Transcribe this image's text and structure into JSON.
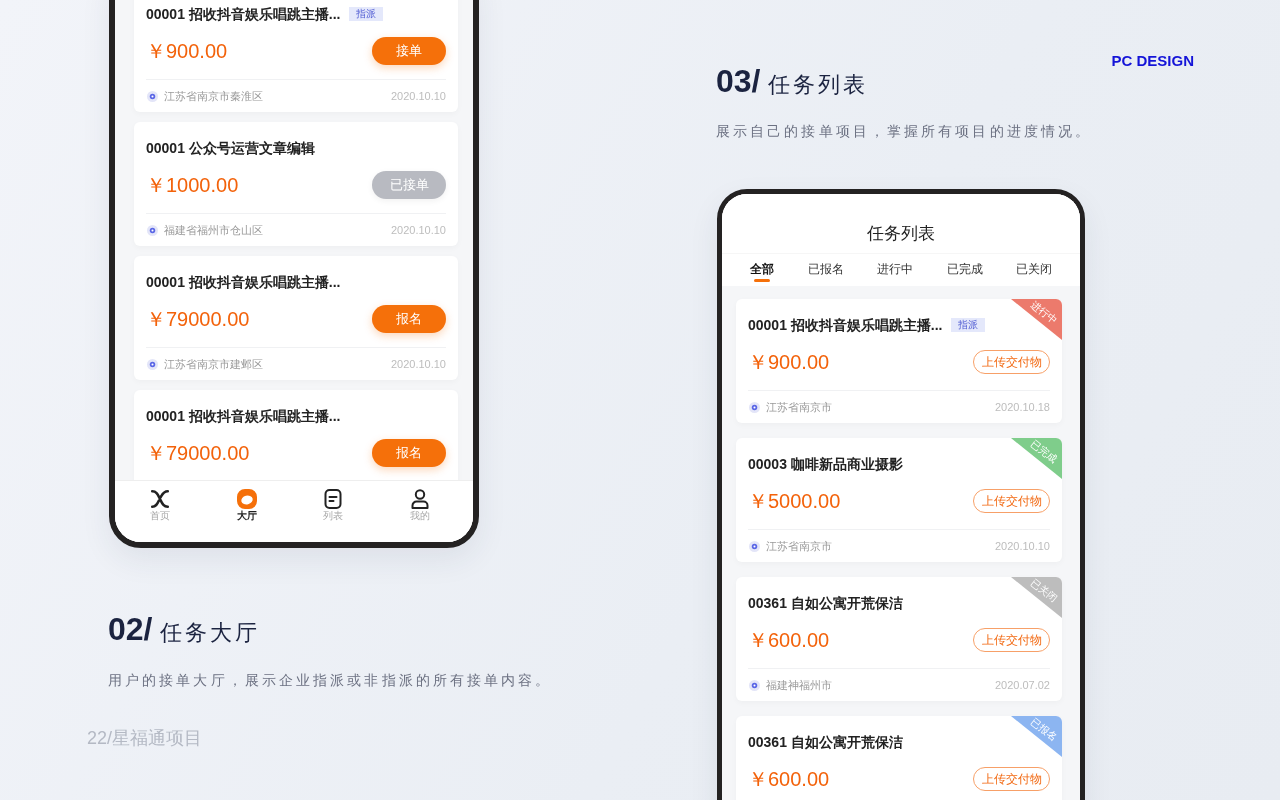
{
  "hall_phone": {
    "cards": [
      {
        "title": "00001 招收抖音娱乐唱跳主播...",
        "tag": "指派",
        "price": "￥900.00",
        "button": {
          "label": "接单",
          "disabled": false
        },
        "location": "江苏省南京市秦淮区",
        "date": "2020.10.10"
      },
      {
        "title": "00001 公众号运营文章编辑",
        "price": "￥1000.00",
        "button": {
          "label": "已接单",
          "disabled": true
        },
        "location": "福建省福州市仓山区",
        "date": "2020.10.10"
      },
      {
        "title": "00001 招收抖音娱乐唱跳主播...",
        "price": "￥79000.00",
        "button": {
          "label": "报名",
          "disabled": false
        },
        "location": "江苏省南京市建邺区",
        "date": "2020.10.10"
      },
      {
        "title": "00001 招收抖音娱乐唱跳主播...",
        "price": "￥79000.00",
        "button": {
          "label": "报名",
          "disabled": false
        }
      }
    ],
    "tab_bar": [
      {
        "label": "首页",
        "selected": false
      },
      {
        "label": "大厅",
        "selected": true
      },
      {
        "label": "列表",
        "selected": false
      },
      {
        "label": "我的",
        "selected": false
      }
    ]
  },
  "list_section": {
    "number": "03/",
    "title": "任务列表",
    "description": "展示自己的接单项目，掌握所有项目的进度情况。"
  },
  "corner_label": "PC DESIGN",
  "list_phone": {
    "title": "任务列表",
    "tabs": [
      {
        "label": "全部",
        "selected": true
      },
      {
        "label": "已报名",
        "selected": false
      },
      {
        "label": "进行中",
        "selected": false
      },
      {
        "label": "已完成",
        "selected": false
      },
      {
        "label": "已关闭",
        "selected": false
      }
    ],
    "cards": [
      {
        "title": "00001 招收抖音娱乐唱跳主播...",
        "tag": "指派",
        "status": {
          "label": "进行中",
          "color": "#ec7a6c"
        },
        "price": "￥900.00",
        "button": "上传交付物",
        "location": "江苏省南京市",
        "date": "2020.10.18"
      },
      {
        "title": "00003 咖啡新品商业摄影",
        "status": {
          "label": "已完成",
          "color": "#7fcd8b"
        },
        "price": "￥5000.00",
        "button": "上传交付物",
        "location": "江苏省南京市",
        "date": "2020.10.10"
      },
      {
        "title": "00361 自如公寓开荒保洁",
        "status": {
          "label": "已关闭",
          "color": "#bdbdbd"
        },
        "price": "￥600.00",
        "button": "上传交付物",
        "location": "福建神福州市",
        "date": "2020.07.02"
      },
      {
        "title": "00361 自如公寓开荒保洁",
        "status": {
          "label": "已报名",
          "color": "#8cb5f1"
        },
        "price": "￥600.00",
        "button": "上传交付物"
      }
    ]
  },
  "hall_section": {
    "number": "02/",
    "title": "任务大厅",
    "description": "用户的接单大厅，展示企业指派或非指派的所有接单内容。"
  },
  "footer": "22/星福通项目"
}
